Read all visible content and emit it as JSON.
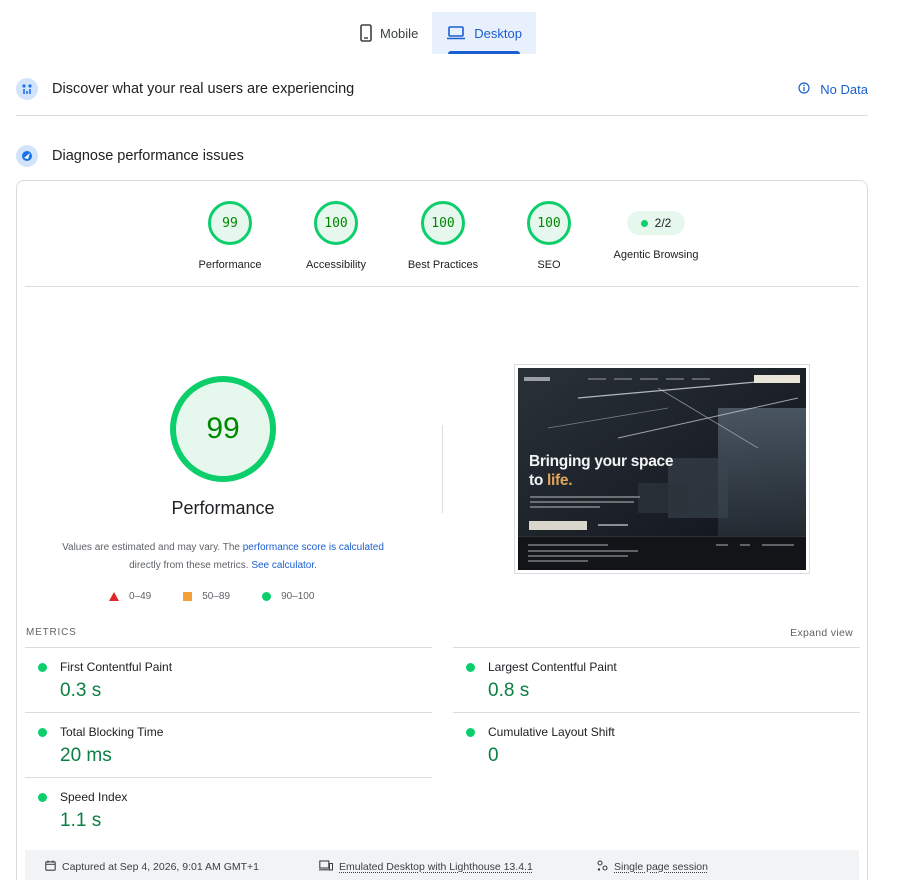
{
  "device_tabs": [
    {
      "label": "Mobile",
      "icon": "phone-icon",
      "active": false
    },
    {
      "label": "Desktop",
      "icon": "laptop-icon",
      "active": true
    }
  ],
  "discover": {
    "icon": "users-chart-icon",
    "title": "Discover what your real users are experiencing",
    "status_icon": "info-icon",
    "status": "No Data"
  },
  "diagnose": {
    "icon": "lighthouse-icon",
    "title": "Diagnose performance issues"
  },
  "categories": [
    {
      "score": "99",
      "label": "Performance"
    },
    {
      "score": "100",
      "label": "Accessibility"
    },
    {
      "score": "100",
      "label": "Best Practices"
    },
    {
      "score": "100",
      "label": "SEO"
    },
    {
      "score": "2/2",
      "label": "Agentic Browsing"
    }
  ],
  "summary": {
    "score": "99",
    "title": "Performance",
    "note_prefix": "Values are estimated and may vary. The ",
    "note_link1": "performance score is calculated",
    "note_middle": " directly from these metrics. ",
    "note_link2": "See calculator",
    "note_suffix": "."
  },
  "legend": [
    {
      "shape": "triangle",
      "color": "#e0272b",
      "range": "0–49"
    },
    {
      "shape": "square",
      "color": "#f4a13a",
      "range": "50–89"
    },
    {
      "shape": "circle",
      "color": "#0cce6b",
      "range": "90–100"
    }
  ],
  "screenshot": {
    "headline_line1": "Bringing your space",
    "headline_to": "to ",
    "headline_accent": "life."
  },
  "metrics": {
    "header": "METRICS",
    "expand": "Expand view",
    "items": [
      {
        "name": "First Contentful Paint",
        "value": "0.3 s"
      },
      {
        "name": "Largest Contentful Paint",
        "value": "0.8 s"
      },
      {
        "name": "Total Blocking Time",
        "value": "20 ms"
      },
      {
        "name": "Cumulative Layout Shift",
        "value": "0"
      },
      {
        "name": "Speed Index",
        "value": "1.1 s"
      }
    ]
  },
  "runtime": {
    "captured": "Captured at Sep 4, 2026, 9:01 AM GMT+1",
    "emulated": "Emulated Desktop with Lighthouse 13.4.1",
    "session": "Single page session"
  },
  "colors": {
    "pass": "#0cce6b",
    "pass_text": "#008800",
    "accent": "#1a5fd0"
  }
}
